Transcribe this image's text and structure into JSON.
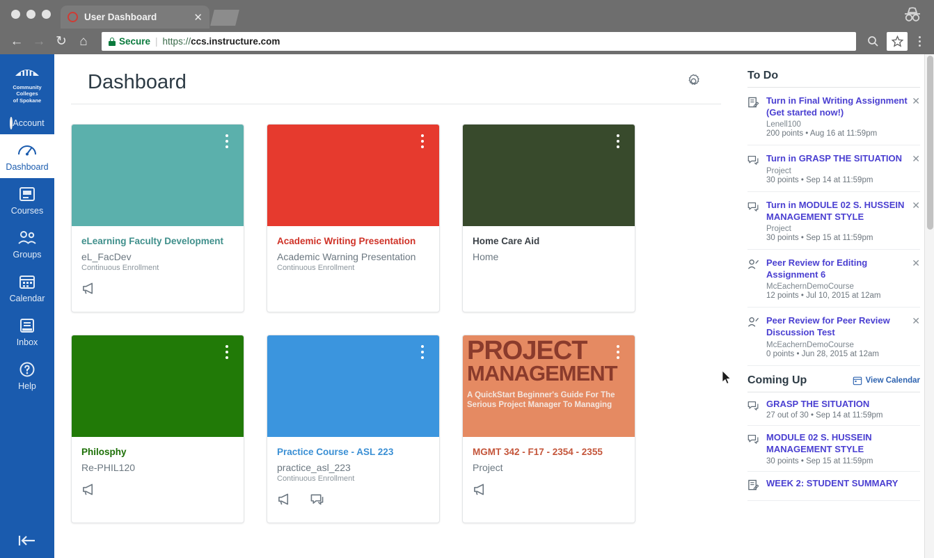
{
  "browser": {
    "tab": {
      "title": "User Dashboard",
      "favicon": "canvas-circle-icon",
      "close_label": "✕"
    },
    "nav": {
      "back": "←",
      "forward": "→",
      "reload": "↻",
      "home": "⌂"
    },
    "omnibox": {
      "security_label": "Secure",
      "url_scheme": "https://",
      "url_host": "ccs.instructure.com",
      "separator": "|"
    },
    "incognito_label": "incognito-icon",
    "menu_label": "browser-menu"
  },
  "sidebar": {
    "logo": {
      "line1": "Community Colleges",
      "line2": "of Spokane"
    },
    "items": [
      {
        "label": "Account",
        "icon": "avatar-icon",
        "active": false
      },
      {
        "label": "Dashboard",
        "icon": "dashboard-gauge-icon",
        "active": true
      },
      {
        "label": "Courses",
        "icon": "courses-book-icon",
        "active": false
      },
      {
        "label": "Groups",
        "icon": "groups-people-icon",
        "active": false
      },
      {
        "label": "Calendar",
        "icon": "calendar-icon",
        "active": false
      },
      {
        "label": "Inbox",
        "icon": "inbox-tray-icon",
        "active": false
      },
      {
        "label": "Help",
        "icon": "help-question-icon",
        "active": false
      }
    ],
    "collapse_label": "collapse-nav-icon",
    "accent_color": "#1a5bae"
  },
  "main": {
    "page_title": "Dashboard",
    "settings_label": "dashboard-options-gear",
    "cards": [
      {
        "title": "eLearning Faculty Development",
        "code": "eL_FacDev",
        "term": "Continuous Enrollment",
        "color": "#5bb0ac",
        "title_color": "#3f8f8b",
        "icons": [
          "announcement-icon"
        ],
        "image": null
      },
      {
        "title": "Academic Writing Presentation",
        "code": "Academic Warning Presentation",
        "term": "Continuous Enrollment",
        "color": "#e63a2e",
        "title_color": "#cf3227",
        "icons": [],
        "image": null
      },
      {
        "title": "Home Care Aid",
        "code": "Home",
        "term": "",
        "color": "#384a2c",
        "title_color": "#3b4147",
        "icons": [],
        "image": null
      },
      {
        "title": "Philosphy",
        "code": "Re-PHIL120",
        "term": "",
        "color": "#217a07",
        "title_color": "#1d7007",
        "icons": [
          "announcement-icon"
        ],
        "image": null
      },
      {
        "title": "Practice Course - ASL 223",
        "code": "practice_asl_223",
        "term": "Continuous Enrollment",
        "color": "#3b95de",
        "title_color": "#3a8fd4",
        "icons": [
          "announcement-icon",
          "discussion-icon"
        ],
        "image": null
      },
      {
        "title": "MGMT 342 - F17 - 2354 - 2355",
        "code": "Project",
        "term": "",
        "color": "#e58a62",
        "title_color": "#c4553a",
        "icons": [
          "announcement-icon"
        ],
        "image": {
          "line1": "PROJECT",
          "line2": "MANAGEMENT",
          "subtitle": "A QuickStart Beginner's Guide For The Serious Project Manager To Managing"
        }
      }
    ]
  },
  "todo": {
    "heading": "To Do",
    "items": [
      {
        "title": "Turn in Final Writing Assignment (Get started now!)",
        "course": "Lenell100",
        "meta": "200 points • Aug 16 at 11:59pm",
        "icon": "assignment-icon",
        "dismiss": "✕"
      },
      {
        "title": "Turn in GRASP THE SITUATION",
        "course": "Project",
        "meta": "30 points • Sep 14 at 11:59pm",
        "icon": "discussion-icon",
        "dismiss": "✕"
      },
      {
        "title": "Turn in MODULE 02 S. HUSSEIN MANAGEMENT STYLE",
        "course": "Project",
        "meta": "30 points • Sep 15 at 11:59pm",
        "icon": "discussion-icon",
        "dismiss": "✕"
      },
      {
        "title": "Peer Review for Editing Assignment 6",
        "course": "McEachernDemoCourse",
        "meta": "12 points • Jul 10, 2015 at 12am",
        "icon": "peer-review-icon",
        "dismiss": "✕"
      },
      {
        "title": "Peer Review for Peer Review Discussion Test",
        "course": "McEachernDemoCourse",
        "meta": "0 points • Jun 28, 2015 at 12am",
        "icon": "peer-review-icon",
        "dismiss": "✕"
      }
    ]
  },
  "coming_up": {
    "heading": "Coming Up",
    "view_calendar_label": "View Calendar",
    "items": [
      {
        "title": "GRASP THE SITUATION",
        "meta": "27 out of 30 • Sep 14 at 11:59pm",
        "icon": "discussion-icon"
      },
      {
        "title": "MODULE 02 S. HUSSEIN MANAGEMENT STYLE",
        "meta": "30 points • Sep 15 at 11:59pm",
        "icon": "discussion-icon"
      },
      {
        "title": "WEEK 2: STUDENT SUMMARY",
        "meta": "",
        "icon": "assignment-icon"
      }
    ]
  }
}
